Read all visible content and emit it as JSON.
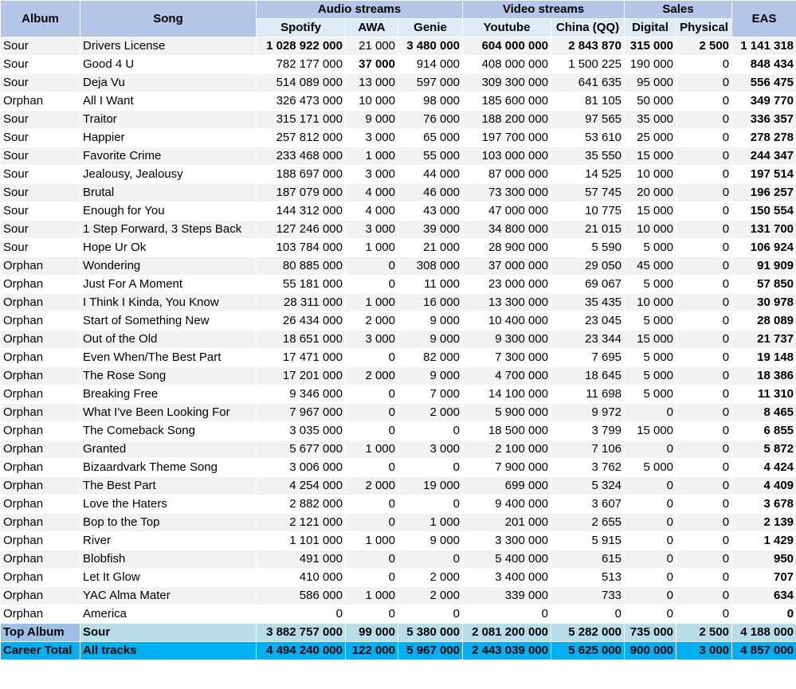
{
  "chart_data": {
    "type": "table",
    "headers": {
      "album": "Album",
      "song": "Song",
      "audio_group": "Audio streams",
      "video_group": "Video streams",
      "sales_group": "Sales",
      "eas": "EAS",
      "columns": [
        "Spotify",
        "AWA",
        "Genie",
        "Youtube",
        "China (QQ)",
        "Digital",
        "Physical"
      ]
    },
    "rows": [
      {
        "album": "Sour",
        "song": "Drivers License",
        "values": [
          "1 028 922 000",
          "21 000",
          "3 480 000",
          "604 000 000",
          "2 843 870",
          "315 000",
          "2 500"
        ],
        "eas": "1 141 318"
      },
      {
        "album": "Sour",
        "song": "Good 4 U",
        "values": [
          "782 177 000",
          "37 000",
          "914 000",
          "408 000 000",
          "1 500 225",
          "190 000",
          "0"
        ],
        "eas": "848 434"
      },
      {
        "album": "Sour",
        "song": "Deja Vu",
        "values": [
          "514 089 000",
          "13 000",
          "597 000",
          "309 300 000",
          "641 635",
          "95 000",
          "0"
        ],
        "eas": "556 475"
      },
      {
        "album": "Orphan",
        "song": "All I Want",
        "values": [
          "326 473 000",
          "10 000",
          "98 000",
          "185 600 000",
          "81 105",
          "50 000",
          "0"
        ],
        "eas": "349 770"
      },
      {
        "album": "Sour",
        "song": "Traitor",
        "values": [
          "315 171 000",
          "9 000",
          "76 000",
          "188 200 000",
          "97 565",
          "35 000",
          "0"
        ],
        "eas": "336 357"
      },
      {
        "album": "Sour",
        "song": "Happier",
        "values": [
          "257 812 000",
          "3 000",
          "65 000",
          "197 700 000",
          "53 610",
          "25 000",
          "0"
        ],
        "eas": "278 278"
      },
      {
        "album": "Sour",
        "song": "Favorite Crime",
        "values": [
          "233 468 000",
          "1 000",
          "55 000",
          "103 000 000",
          "35 550",
          "15 000",
          "0"
        ],
        "eas": "244 347"
      },
      {
        "album": "Sour",
        "song": "Jealousy, Jealousy",
        "values": [
          "188 697 000",
          "3 000",
          "44 000",
          "87 000 000",
          "14 525",
          "10 000",
          "0"
        ],
        "eas": "197 514"
      },
      {
        "album": "Sour",
        "song": "Brutal",
        "values": [
          "187 079 000",
          "4 000",
          "46 000",
          "73 300 000",
          "57 745",
          "20 000",
          "0"
        ],
        "eas": "196 257"
      },
      {
        "album": "Sour",
        "song": "Enough for You",
        "values": [
          "144 312 000",
          "4 000",
          "43 000",
          "47 000 000",
          "10 775",
          "15 000",
          "0"
        ],
        "eas": "150 554"
      },
      {
        "album": "Sour",
        "song": "1 Step Forward, 3 Steps Back",
        "values": [
          "127 246 000",
          "3 000",
          "39 000",
          "34 800 000",
          "21 015",
          "10 000",
          "0"
        ],
        "eas": "131 700"
      },
      {
        "album": "Sour",
        "song": "Hope Ur Ok",
        "values": [
          "103 784 000",
          "1 000",
          "21 000",
          "28 900 000",
          "5 590",
          "5 000",
          "0"
        ],
        "eas": "106 924"
      },
      {
        "album": "Orphan",
        "song": "Wondering",
        "values": [
          "80 885 000",
          "0",
          "308 000",
          "37 000 000",
          "29 050",
          "45 000",
          "0"
        ],
        "eas": "91 909"
      },
      {
        "album": "Orphan",
        "song": "Just For A Moment",
        "values": [
          "55 181 000",
          "0",
          "11 000",
          "23 000 000",
          "69 067",
          "5 000",
          "0"
        ],
        "eas": "57 850"
      },
      {
        "album": "Orphan",
        "song": "I Think I Kinda, You Know",
        "values": [
          "28 311 000",
          "1 000",
          "16 000",
          "13 300 000",
          "35 435",
          "10 000",
          "0"
        ],
        "eas": "30 978"
      },
      {
        "album": "Orphan",
        "song": "Start of Something New",
        "values": [
          "26 434 000",
          "2 000",
          "9 000",
          "10 400 000",
          "23 045",
          "5 000",
          "0"
        ],
        "eas": "28 089"
      },
      {
        "album": "Orphan",
        "song": "Out of the Old",
        "values": [
          "18 651 000",
          "3 000",
          "9 000",
          "9 300 000",
          "23 344",
          "15 000",
          "0"
        ],
        "eas": "21 737"
      },
      {
        "album": "Orphan",
        "song": "Even When/The Best Part",
        "values": [
          "17 471 000",
          "0",
          "82 000",
          "7 300 000",
          "7 695",
          "5 000",
          "0"
        ],
        "eas": "19 148"
      },
      {
        "album": "Orphan",
        "song": "The Rose Song",
        "values": [
          "17 201 000",
          "2 000",
          "9 000",
          "4 700 000",
          "18 645",
          "5 000",
          "0"
        ],
        "eas": "18 386"
      },
      {
        "album": "Orphan",
        "song": "Breaking Free",
        "values": [
          "9 346 000",
          "0",
          "7 000",
          "14 100 000",
          "11 698",
          "5 000",
          "0"
        ],
        "eas": "11 310"
      },
      {
        "album": "Orphan",
        "song": "What I've Been Looking For",
        "values": [
          "7 967 000",
          "0",
          "2 000",
          "5 900 000",
          "9 972",
          "0",
          "0"
        ],
        "eas": "8 465"
      },
      {
        "album": "Orphan",
        "song": "The Comeback Song",
        "values": [
          "3 035 000",
          "0",
          "0",
          "18 500 000",
          "3 799",
          "15 000",
          "0"
        ],
        "eas": "6 855"
      },
      {
        "album": "Orphan",
        "song": "Granted",
        "values": [
          "5 677 000",
          "1 000",
          "3 000",
          "2 100 000",
          "7 106",
          "0",
          "0"
        ],
        "eas": "5 872"
      },
      {
        "album": "Orphan",
        "song": "Bizaardvark Theme Song",
        "values": [
          "3 006 000",
          "0",
          "0",
          "7 900 000",
          "3 762",
          "5 000",
          "0"
        ],
        "eas": "4 424"
      },
      {
        "album": "Orphan",
        "song": "The Best Part",
        "values": [
          "4 254 000",
          "2 000",
          "19 000",
          "699 000",
          "5 324",
          "0",
          "0"
        ],
        "eas": "4 409"
      },
      {
        "album": "Orphan",
        "song": "Love the Haters",
        "values": [
          "2 882 000",
          "0",
          "0",
          "9 400 000",
          "3 607",
          "0",
          "0"
        ],
        "eas": "3 678"
      },
      {
        "album": "Orphan",
        "song": "Bop to the Top",
        "values": [
          "2 121 000",
          "0",
          "1 000",
          "201 000",
          "2 655",
          "0",
          "0"
        ],
        "eas": "2 139"
      },
      {
        "album": "Orphan",
        "song": "River",
        "values": [
          "1 101 000",
          "1 000",
          "9 000",
          "3 300 000",
          "5 915",
          "0",
          "0"
        ],
        "eas": "1 429"
      },
      {
        "album": "Orphan",
        "song": "Blobfish",
        "values": [
          "491 000",
          "0",
          "0",
          "5 400 000",
          "615",
          "0",
          "0"
        ],
        "eas": "950"
      },
      {
        "album": "Orphan",
        "song": "Let It Glow",
        "values": [
          "410 000",
          "0",
          "2 000",
          "3 400 000",
          "513",
          "0",
          "0"
        ],
        "eas": "707"
      },
      {
        "album": "Orphan",
        "song": "YAC Alma Mater",
        "values": [
          "586 000",
          "1 000",
          "2 000",
          "339 000",
          "733",
          "0",
          "0"
        ],
        "eas": "634"
      },
      {
        "album": "Orphan",
        "song": "America",
        "values": [
          "0",
          "0",
          "0",
          "0",
          "0",
          "0",
          "0"
        ],
        "eas": "0"
      }
    ],
    "summary": [
      {
        "label": "Top Album",
        "name": "Sour",
        "values": [
          "3 882 757 000",
          "99 000",
          "5 380 000",
          "2 081 200 000",
          "5 282 000",
          "735 000",
          "2 500"
        ],
        "eas": "4 188 000"
      },
      {
        "label": "Career Total",
        "name": "All tracks",
        "values": [
          "4 494 240 000",
          "122 000",
          "5 967 000",
          "2 443 039 000",
          "5 625 000",
          "900 000",
          "3 000"
        ],
        "eas": "4 857 000"
      }
    ],
    "highlight_colors": {
      "record_value": "#2f75b5",
      "header": "#b4c6e7",
      "subheader": "#ddebf7",
      "top_album_row": "#b7dee8",
      "career_row": "#00b0f0"
    }
  }
}
